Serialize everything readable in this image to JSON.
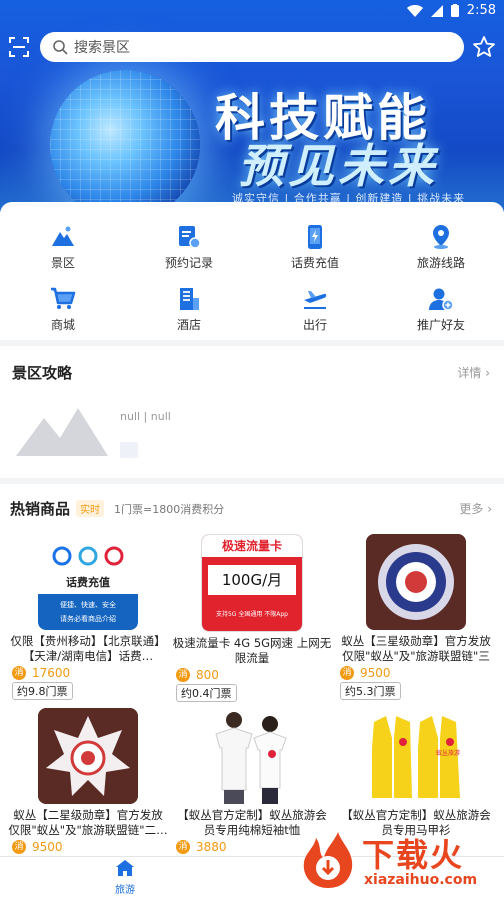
{
  "status": {
    "time": "2:58"
  },
  "search": {
    "placeholder": "搜索景区"
  },
  "banner": {
    "title_line1": "科技赋能",
    "title_line2": "预见未来",
    "subtitle": "诚实守信 | 合作共赢 | 创新建造 | 挑战未来"
  },
  "menu": [
    {
      "label": "景区",
      "icon": "mountain-icon"
    },
    {
      "label": "预约记录",
      "icon": "calendar-record-icon"
    },
    {
      "label": "话费充值",
      "icon": "phone-charge-icon"
    },
    {
      "label": "旅游线路",
      "icon": "map-pin-icon"
    },
    {
      "label": "商城",
      "icon": "cart-icon"
    },
    {
      "label": "酒店",
      "icon": "hotel-icon"
    },
    {
      "label": "出行",
      "icon": "plane-icon"
    },
    {
      "label": "推广好友",
      "icon": "add-friend-icon"
    }
  ],
  "guide": {
    "title": "景区攻略",
    "more": "详情 ›",
    "item_text": "null | null"
  },
  "goods": {
    "title": "热销商品",
    "tag": "实时",
    "rate": "1门票=1800消费积分",
    "more": "更多 ›",
    "consume_badge": "消",
    "items": [
      {
        "name": "仅限【贵州移动】【北京联通】【天津/湖南电信】话费…",
        "price": "17600",
        "ticket": "约9.8门票",
        "pic_text": "话费充值",
        "pic_sub": "便捷、快速、安全",
        "pic_sub2": "请务必看商品介绍"
      },
      {
        "name": "极速流量卡 4G 5G网速 上网无限流量",
        "price": "800",
        "ticket": "约0.4门票",
        "pic_text": "极速流量卡",
        "pic_sub": "100G/月",
        "pic_sub2": "支持5G 全国通用 不限App"
      },
      {
        "name": "蚁丛【三星级勋章】官方发放仅限\"蚁丛\"及\"旅游联盟链\"三星…",
        "price": "9500",
        "ticket": "约5.3门票"
      },
      {
        "name": "蚁丛【二星级勋章】官方发放仅限\"蚁丛\"及\"旅游联盟链\"二…",
        "price": "9500"
      },
      {
        "name": "【蚁丛官方定制】蚁丛旅游会员专用纯棉短袖t恤",
        "price": "3880"
      },
      {
        "name": "【蚁丛官方定制】蚁丛旅游会员专用马甲衫",
        "price": "",
        "pic_text": "蚁丛旅游"
      }
    ]
  },
  "tabbar": {
    "home": "旅游"
  },
  "watermark": {
    "text": "下载火",
    "url": "xiazaihuo.com"
  },
  "colors": {
    "primary": "#1e6fe0",
    "accent": "#f29a12",
    "watermark": "#e8461e"
  }
}
